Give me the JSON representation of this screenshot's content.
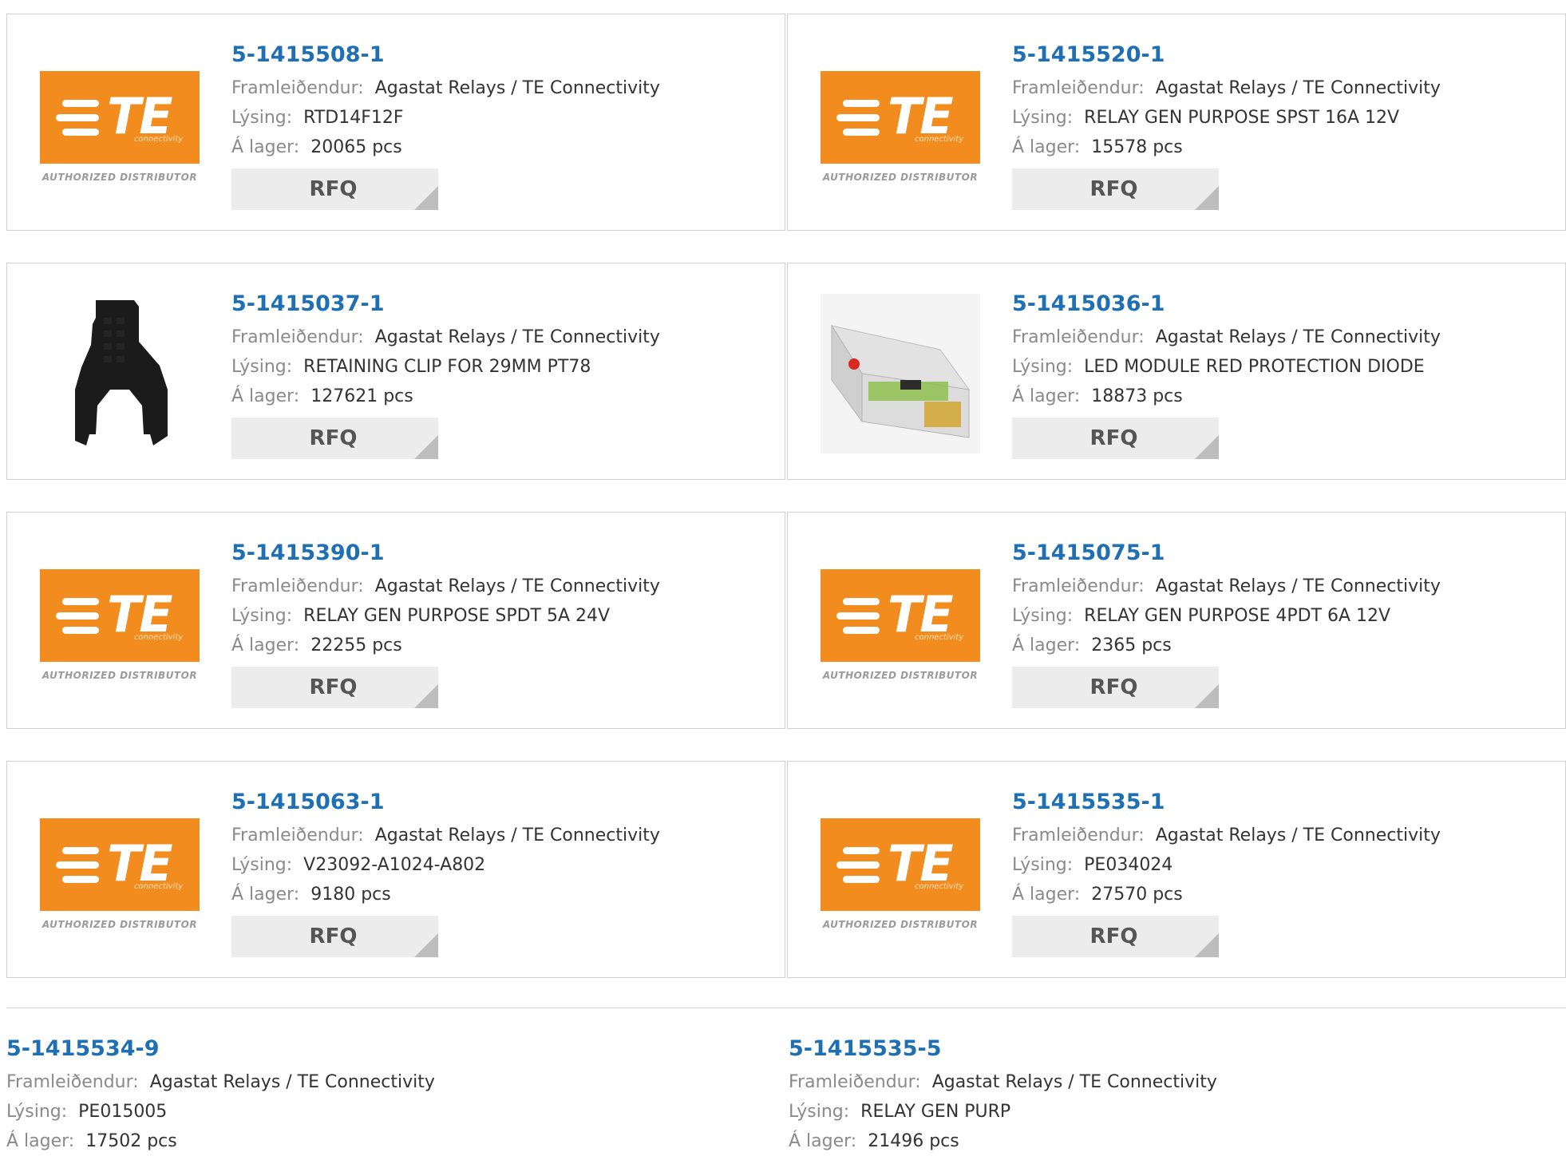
{
  "labels": {
    "manufacturer": "Framleiðendur:",
    "description": "Lýsing:",
    "stock": "Á lager:",
    "rfq": "RFQ"
  },
  "logo": {
    "brand": "TE",
    "sub": "connectivity",
    "tagline": "AUTHORIZED DISTRIBUTOR",
    "color": "#f28c1f"
  },
  "products": [
    {
      "pn": "5-1415508-1",
      "manufacturer": "Agastat Relays / TE Connectivity",
      "description": "RTD14F12F",
      "stock": "20065 pcs",
      "image": "te-logo"
    },
    {
      "pn": "5-1415520-1",
      "manufacturer": "Agastat Relays / TE Connectivity",
      "description": "RELAY GEN PURPOSE SPST 16A 12V",
      "stock": "15578 pcs",
      "image": "te-logo"
    },
    {
      "pn": "5-1415037-1",
      "manufacturer": "Agastat Relays / TE Connectivity",
      "description": "RETAINING CLIP FOR 29MM PT78",
      "stock": "127621 pcs",
      "image": "retaining-clip"
    },
    {
      "pn": "5-1415036-1",
      "manufacturer": "Agastat Relays / TE Connectivity",
      "description": "LED MODULE RED PROTECTION DIODE",
      "stock": "18873 pcs",
      "image": "led-module"
    },
    {
      "pn": "5-1415390-1",
      "manufacturer": "Agastat Relays / TE Connectivity",
      "description": "RELAY GEN PURPOSE SPDT 5A 24V",
      "stock": "22255 pcs",
      "image": "te-logo"
    },
    {
      "pn": "5-1415075-1",
      "manufacturer": "Agastat Relays / TE Connectivity",
      "description": "RELAY GEN PURPOSE 4PDT 6A 12V",
      "stock": "2365 pcs",
      "image": "te-logo"
    },
    {
      "pn": "5-1415063-1",
      "manufacturer": "Agastat Relays / TE Connectivity",
      "description": "V23092-A1024-A802",
      "stock": "9180 pcs",
      "image": "te-logo"
    },
    {
      "pn": "5-1415535-1",
      "manufacturer": "Agastat Relays / TE Connectivity",
      "description": "PE034024",
      "stock": "27570 pcs",
      "image": "te-logo"
    }
  ],
  "bottom": [
    {
      "pn": "5-1415534-9",
      "manufacturer": "Agastat Relays / TE Connectivity",
      "description": "PE015005",
      "stock": "17502 pcs"
    },
    {
      "pn": "5-1415535-5",
      "manufacturer": "Agastat Relays / TE Connectivity",
      "description": "RELAY GEN PURP",
      "stock": "21496 pcs"
    }
  ]
}
